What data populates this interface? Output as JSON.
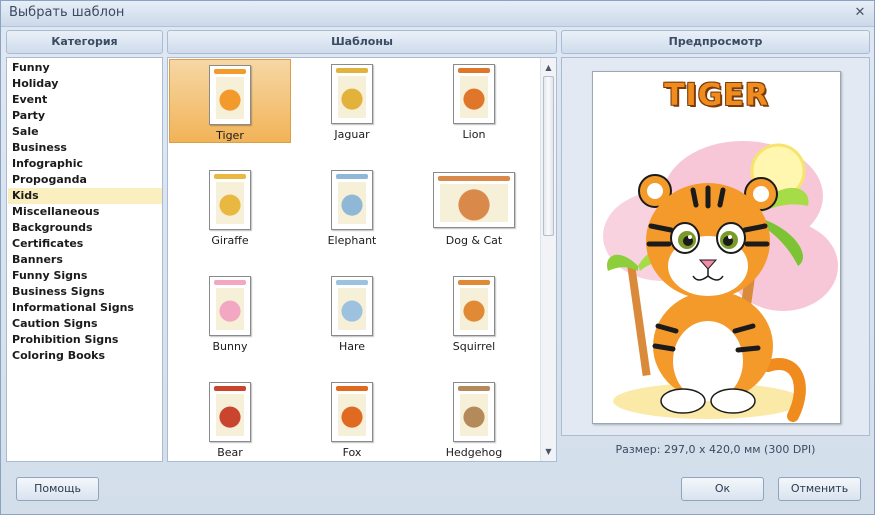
{
  "window": {
    "title": "Выбрать шаблон"
  },
  "headers": {
    "category": "Категория",
    "templates": "Шаблоны",
    "preview": "Предпросмотр"
  },
  "categories": [
    "Funny",
    "Holiday",
    "Event",
    "Party",
    "Sale",
    "Business",
    "Infographic",
    "Propoganda",
    "Kids",
    "Miscellaneous",
    "Backgrounds",
    "Certificates",
    "Banners",
    "Funny Signs",
    "Business Signs",
    "Informational Signs",
    "Caution Signs",
    "Prohibition Signs",
    "Coloring Books"
  ],
  "selected_category": "Kids",
  "templates": [
    {
      "label": "Tiger",
      "icon": "tiger-thumbnail-icon",
      "color": "#f39a2c"
    },
    {
      "label": "Jaguar",
      "icon": "jaguar-thumbnail-icon",
      "color": "#e3b23c"
    },
    {
      "label": "Lion",
      "icon": "lion-thumbnail-icon",
      "color": "#e0762a"
    },
    {
      "label": "Giraffe",
      "icon": "giraffe-thumbnail-icon",
      "color": "#e9b840"
    },
    {
      "label": "Elephant",
      "icon": "elephant-thumbnail-icon",
      "color": "#8fb7d6"
    },
    {
      "label": "Dog & Cat",
      "icon": "dog-and-cat-thumbnail-icon",
      "color": "#d98a4a"
    },
    {
      "label": "Bunny",
      "icon": "bunny-thumbnail-icon",
      "color": "#f2a7c3"
    },
    {
      "label": "Hare",
      "icon": "hare-thumbnail-icon",
      "color": "#9cc2e0"
    },
    {
      "label": "Squirrel",
      "icon": "squirrel-thumbnail-icon",
      "color": "#e08a35"
    },
    {
      "label": "Bear",
      "icon": "bear-thumbnail-icon",
      "color": "#c9452d"
    },
    {
      "label": "Fox",
      "icon": "fox-thumbnail-icon",
      "color": "#e06a22"
    },
    {
      "label": "Hedgehog",
      "icon": "hedgehog-thumbnail-icon",
      "color": "#b58a5a"
    }
  ],
  "selected_template": "Tiger",
  "preview": {
    "title": "TIGER",
    "size_text": "Размер: 297,0 x 420,0 мм (300 DPI)",
    "accent_color": "#f08c1e"
  },
  "buttons": {
    "help": "Помощь",
    "ok": "Ок",
    "cancel": "Отменить"
  }
}
